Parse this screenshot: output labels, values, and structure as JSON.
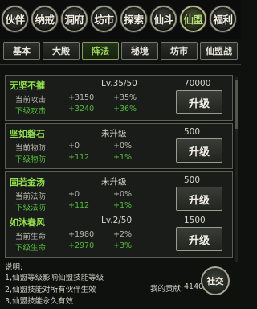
{
  "top_tabs": [
    "伙伴",
    "纳戒",
    "洞府",
    "坊市",
    "探索",
    "仙斗",
    "仙盟",
    "福利"
  ],
  "top_active": 6,
  "sub_tabs": [
    "基本",
    "大殿",
    "阵法",
    "秘境",
    "坊市",
    "仙盟战"
  ],
  "sub_active": 2,
  "cards": [
    {
      "title": "无坚不摧",
      "level": "Lv.35/50",
      "cost": "70000",
      "cur": {
        "label": "当前攻击",
        "v1": "+3150",
        "v2": "+35%"
      },
      "next": {
        "label": "下级攻击",
        "v1": "+3240",
        "v2": "+36%"
      },
      "button": "升级"
    },
    {
      "title": "坚如磐石",
      "level": "未升级",
      "cost": "500",
      "cur": {
        "label": "当前物防",
        "v1": "+0",
        "v2": "+0%"
      },
      "next": {
        "label": "下级物防",
        "v1": "+112",
        "v2": "+1%"
      },
      "button": "升级"
    },
    {
      "title": "固若金汤",
      "level": "未升级",
      "cost": "500",
      "cur": {
        "label": "当前法防",
        "v1": "+0",
        "v2": "+0%"
      },
      "next": {
        "label": "下级法防",
        "v1": "+112",
        "v2": "+1%"
      },
      "button": "升级"
    },
    {
      "title": "如沐春风",
      "level": "Lv.2/50",
      "cost": "1500",
      "cur": {
        "label": "当前生命",
        "v1": "+1980",
        "v2": "+2%"
      },
      "next": {
        "label": "下级生命",
        "v1": "+2970",
        "v2": "+3%"
      },
      "button": "升级"
    }
  ],
  "footer": {
    "heading": "说明:",
    "lines": [
      "1,仙盟等级影响仙盟技能等级",
      "2,仙盟技能对所有伙伴生效",
      "3,仙盟技能永久有效"
    ],
    "contribution_label": "我的贡献:",
    "contribution_value": "41402",
    "guild_button": "社交"
  }
}
